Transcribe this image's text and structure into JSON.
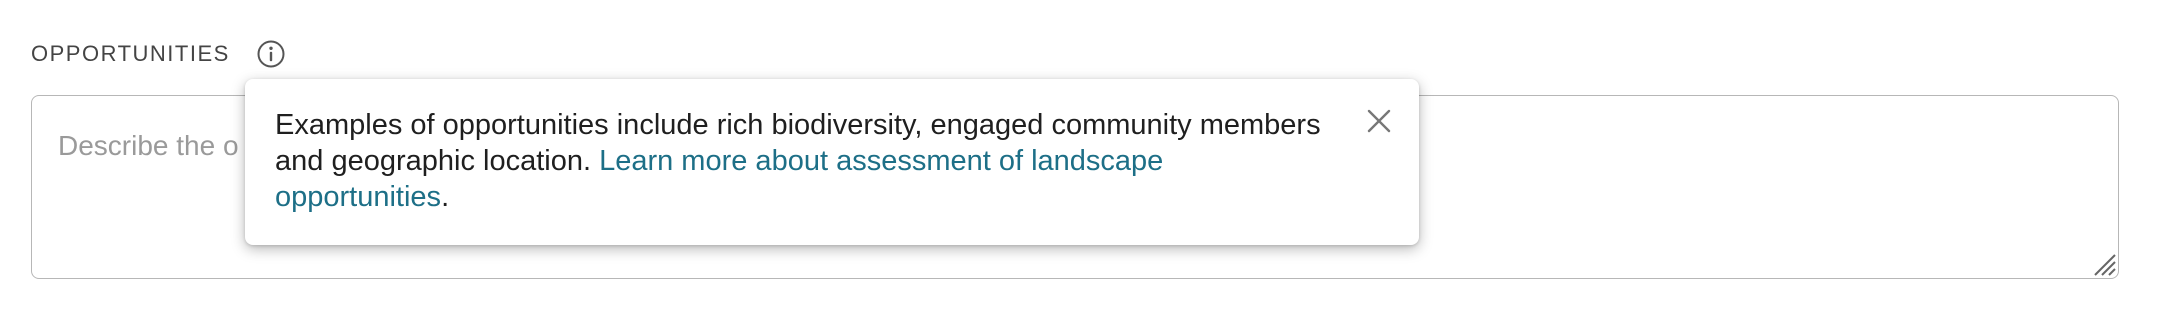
{
  "field": {
    "label": "OPPORTUNITIES",
    "info_icon": "info-icon",
    "placeholder": "Describe the o"
  },
  "tooltip": {
    "text_before": "Examples of opportunities include rich biodiversity, engaged community members and geographic location. ",
    "link_text": "Learn more about assessment of landscape opportunities",
    "text_after": ".",
    "close_icon": "close-icon"
  },
  "colors": {
    "link": "#1d6f87",
    "label": "#444444",
    "border": "#b7b7b7",
    "placeholder": "#9a9a9a"
  }
}
